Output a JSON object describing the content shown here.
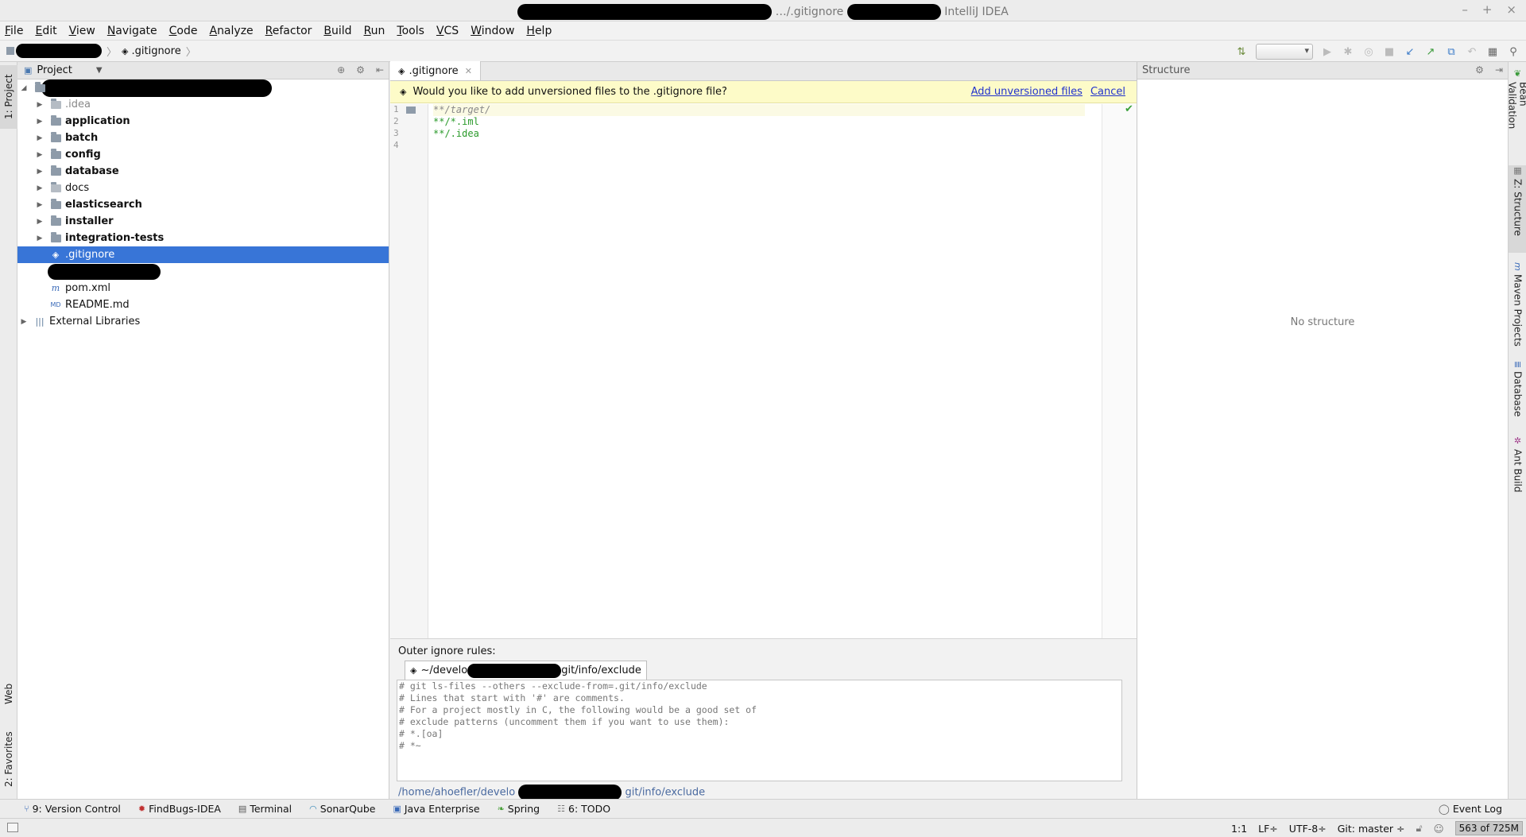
{
  "window": {
    "title_mid": "…/.gitignore",
    "title_app": "IntelliJ IDEA",
    "controls": [
      "–",
      "+",
      "×"
    ]
  },
  "menu": [
    "File",
    "Edit",
    "View",
    "Navigate",
    "Code",
    "Analyze",
    "Refactor",
    "Build",
    "Run",
    "Tools",
    "VCS",
    "Window",
    "Help"
  ],
  "breadcrumb": {
    "file": ".gitignore"
  },
  "project_panel": {
    "title": "Project",
    "tree": [
      {
        "name": ".idea",
        "type": "folder",
        "dim": true
      },
      {
        "name": "application",
        "type": "folder",
        "bold": true
      },
      {
        "name": "batch",
        "type": "folder",
        "bold": true
      },
      {
        "name": "config",
        "type": "folder",
        "bold": true
      },
      {
        "name": "database",
        "type": "folder",
        "bold": true
      },
      {
        "name": "docs",
        "type": "folder"
      },
      {
        "name": "elasticsearch",
        "type": "folder",
        "bold": true
      },
      {
        "name": "installer",
        "type": "folder",
        "bold": true
      },
      {
        "name": "integration-tests",
        "type": "folder",
        "bold": true
      },
      {
        "name": ".gitignore",
        "type": "file",
        "selected": true
      },
      {
        "name": "pom.xml",
        "type": "file"
      },
      {
        "name": "README.md",
        "type": "file"
      },
      {
        "name": "External Libraries",
        "type": "lib"
      }
    ]
  },
  "editor": {
    "tab": ".gitignore",
    "banner": {
      "message": "Would you like to add unversioned files to the .gitignore file?",
      "add_link": "Add unversioned files",
      "cancel_link": "Cancel"
    },
    "line_numbers": [
      "1",
      "2",
      "3",
      "4"
    ],
    "lines": [
      "**/target/",
      "**/*.iml",
      "**/.idea",
      ""
    ],
    "outer_rules": {
      "label": "Outer ignore rules:",
      "tab_prefix": "~/develo",
      "tab_suffix": "git/info/exclude",
      "lines": [
        "# git ls-files --others --exclude-from=.git/info/exclude",
        "# Lines that start with '#' are comments.",
        "# For a project mostly in C, the following would be a good set of",
        "# exclude patterns (uncomment them if you want to use them):",
        "# *.[oa]",
        "# *~"
      ],
      "path_prefix": "/home/ahoefler/develo",
      "path_suffix": "git/info/exclude"
    }
  },
  "structure_panel": {
    "title": "Structure",
    "empty_text": "No structure"
  },
  "left_stripe": {
    "top": "1: Project",
    "web": "Web",
    "favorites": "2: Favorites"
  },
  "right_stripe": [
    "Bean Validation",
    "Z: Structure",
    "Maven Projects",
    "Database",
    "Ant Build"
  ],
  "bottom_tools": [
    "9: Version Control",
    "FindBugs-IDEA",
    "Terminal",
    "SonarQube",
    "Java Enterprise",
    "Spring",
    "6: TODO"
  ],
  "event_log": "Event Log",
  "status": {
    "position": "1:1",
    "line_sep": "LF÷",
    "encoding": "UTF-8÷",
    "branch": "Git: master ÷",
    "memory": "563 of 725M"
  },
  "colors": {
    "selection": "#3875d7",
    "banner": "#fdfbc8",
    "code": "#2a9a2a",
    "link": "#2233cc"
  }
}
